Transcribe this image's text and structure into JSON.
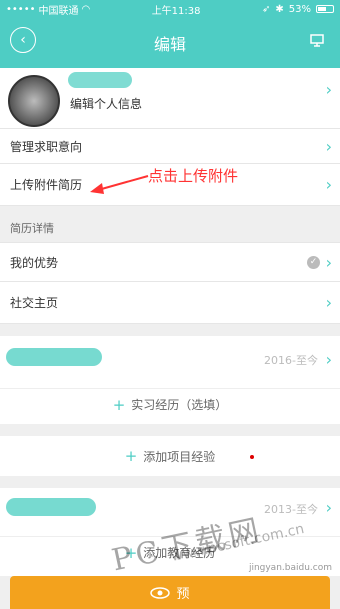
{
  "status": {
    "carrier": "中国联通",
    "time": "上午11:38",
    "battery": "53%"
  },
  "header": {
    "title": "编辑"
  },
  "profile": {
    "edit_label": "编辑个人信息"
  },
  "menu": {
    "job_intent": "管理求职意向",
    "upload_resume": "上传附件简历"
  },
  "annotation": "点击上传附件",
  "resume_section": {
    "label": "简历详情"
  },
  "resume_items": {
    "advantages": "我的优势",
    "social": "社交主页"
  },
  "experience1": {
    "date": "2016-至今",
    "add_label": "实习经历（选填）"
  },
  "project": {
    "add_label": "添加项目经验"
  },
  "education": {
    "date": "2013-至今",
    "add_label": "添加教育经历"
  },
  "footer": {
    "preview_label": "预"
  },
  "watermark": {
    "text": "PC下载网",
    "site": "www.pcsoft.com.cn",
    "small": "jingyan.baidu.com"
  },
  "colors": {
    "accent": "#4ecdc4",
    "footer": "#f3a21d",
    "annotation": "#ff3333"
  }
}
